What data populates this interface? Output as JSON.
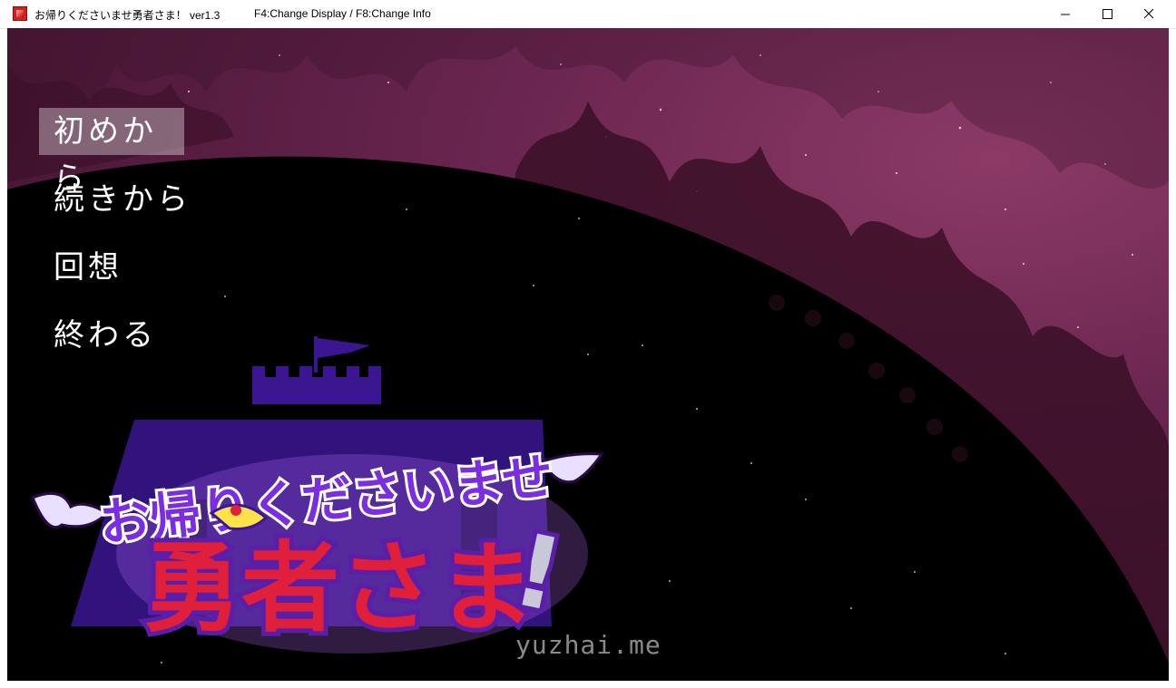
{
  "window": {
    "title": "お帰りくださいませ勇者さま！ ver1.3",
    "info": "F4:Change Display / F8:Change Info",
    "minimize_icon": "minimize-icon",
    "maximize_icon": "maximize-icon",
    "close_icon": "close-icon"
  },
  "menu": {
    "items": [
      {
        "label": "初めから",
        "selected": true
      },
      {
        "label": "続きから",
        "selected": false
      },
      {
        "label": "回想",
        "selected": false
      },
      {
        "label": "終わる",
        "selected": false
      }
    ]
  },
  "logo": {
    "line1": "お帰りくださいませ",
    "line2": "勇者さま",
    "exclaim": "!"
  },
  "watermark": "yuzhai.me",
  "colors": {
    "sky": "#6a2650",
    "hill": "#000000",
    "castle": "#3a1690",
    "logo_red": "#e0203a",
    "logo_purple": "#6a1ed8",
    "menu_highlight": "rgba(255,255,255,0.35)"
  }
}
